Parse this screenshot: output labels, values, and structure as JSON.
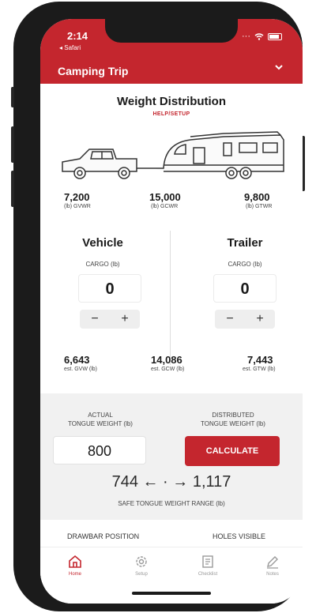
{
  "status": {
    "time": "2:14",
    "back_label": "◂ Safari"
  },
  "header": {
    "title": "Camping Trip",
    "chevron": "chevron-down-icon"
  },
  "page": {
    "title": "Weight Distribution",
    "help": "HELP/SETUP"
  },
  "ratings": {
    "gvwr": {
      "value": "7,200",
      "label": "(lb) GVWR"
    },
    "gcwr": {
      "value": "15,000",
      "label": "(lb) GCWR"
    },
    "gtwr": {
      "value": "9,800",
      "label": "(lb) GTWR"
    }
  },
  "vehicle": {
    "title": "Vehicle",
    "cargo_label": "CARGO (lb)",
    "cargo_value": "0"
  },
  "trailer": {
    "title": "Trailer",
    "cargo_label": "CARGO (lb)",
    "cargo_value": "0"
  },
  "stepper": {
    "minus": "−",
    "plus": "+"
  },
  "estimates": {
    "gvw": {
      "value": "6,643",
      "label": "est. GVW (lb)"
    },
    "gcw": {
      "value": "14,086",
      "label": "est. GCW (lb)"
    },
    "gtw": {
      "value": "7,443",
      "label": "est. GTW (lb)"
    }
  },
  "tongue": {
    "actual_label_1": "ACTUAL",
    "actual_label_2": "TONGUE WEIGHT (lb)",
    "actual_value": "800",
    "dist_label_1": "DISTRIBUTED",
    "dist_label_2": "TONGUE WEIGHT (lb)",
    "calculate": "CALCULATE",
    "range_text": "744 ← · → 1,117",
    "range_label": "SAFE TONGUE WEIGHT RANGE (lb)"
  },
  "bottom": {
    "drawbar": "DRAWBAR POSITION",
    "holes": "HOLES VISIBLE"
  },
  "tabs": [
    {
      "label": "Home",
      "icon": "home-icon"
    },
    {
      "label": "Setup",
      "icon": "gear-icon"
    },
    {
      "label": "Checklist",
      "icon": "checklist-icon"
    },
    {
      "label": "Notes",
      "icon": "pencil-icon"
    }
  ],
  "colors": {
    "brand_red": "#c4262e",
    "panel_gray": "#f1f1f1"
  }
}
